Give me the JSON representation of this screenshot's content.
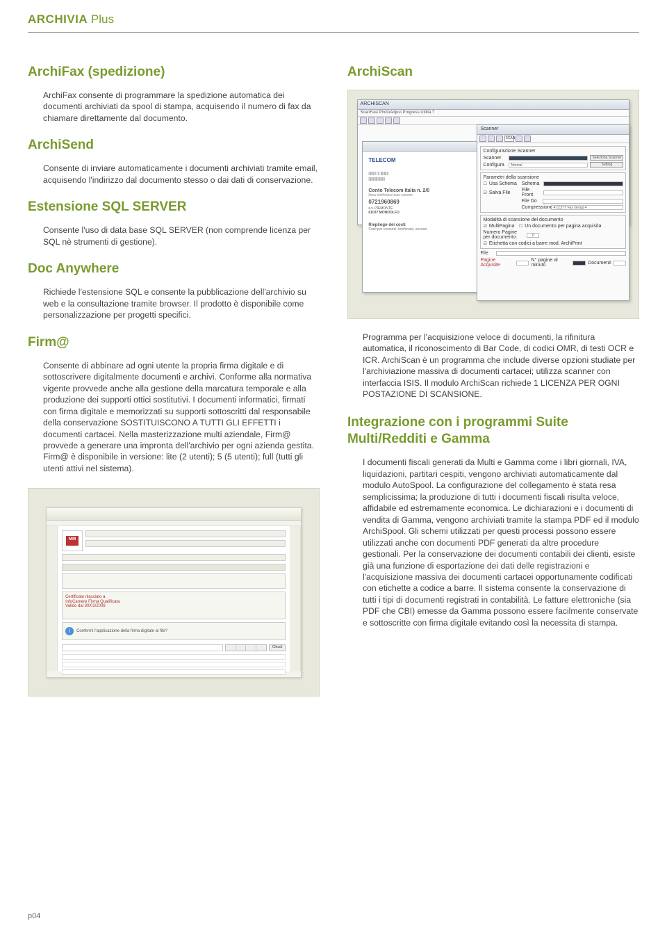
{
  "header": {
    "brand_bold": "ARCHIVIA",
    "brand_light": " Plus"
  },
  "left": {
    "s1": {
      "title": "ArchiFax (spedizione)",
      "body": "ArchiFax consente di programmare la spedizione automatica dei documenti archiviati da spool di stampa, acquisendo il numero di fax da chiamare direttamente dal documento."
    },
    "s2": {
      "title": "ArchiSend",
      "body": "Consente di inviare automaticamente i documenti archiviati tramite email, acquisendo l'indirizzo dal documento stesso o dai dati di conservazione."
    },
    "s3": {
      "title": "Estensione SQL SERVER",
      "body": "Consente l'uso di data base SQL SERVER (non comprende licenza per SQL nè strumenti di gestione)."
    },
    "s4": {
      "title": "Doc Anywhere",
      "body": "Richiede l'estensione SQL e consente la pubblicazione dell'archivio su web e la consultazione tramite browser. Il prodotto è disponibile come personalizzazione per progetti specifici."
    },
    "s5": {
      "title": "Firm@",
      "body": "Consente di abbinare ad ogni utente la propria firma digitale e di sottoscrivere digitalmente documenti e archivi. Conforme alla normativa vigente provvede anche alla gestione della marcatura temporale e alla produzione dei supporti ottici sostitutivi. I documenti informatici, firmati con firma digitale e memorizzati su supporti sottoscritti dal responsabile della conservazione SOSTITUISCONO A TUTTI GLI EFFETTI i documenti cartacei. Nella masterizzazione multi aziendale, Firm@ provvede a generare una impronta dell'archivio per ogni azienda gestita. Firm@ è disponibile in versione: lite (2 utenti); 5 (5 utenti); full (tutti gli utenti attivi nel sistema)."
    }
  },
  "right": {
    "s1": {
      "title": "ArchiScan",
      "body": "Programma per l'acquisizione veloce di documenti, la rifinitura automatica, il riconoscimento di Bar Code, di codici OMR, di testi OCR e ICR. ArchiScan è un programma che include diverse opzioni studiate per l'archiviazione massiva di documenti cartacei; utilizza scanner con interfaccia ISIS. Il modulo ArchiScan richiede 1 LICENZA PER OGNI POSTAZIONE DI SCANSIONE."
    },
    "s2": {
      "title": "Integrazione con i programmi Suite Multi/Redditi e Gamma",
      "body": "I documenti fiscali generati da Multi e Gamma come i libri giornali, IVA, liquidazioni, partitari cespiti, vengono archiviati automaticamente dal modulo AutoSpool. La configurazione del collegamento è stata resa semplicissima; la produzione di tutti i documenti fiscali risulta veloce, affidabile ed estremamente economica. Le dichiarazioni e i documenti di vendita di Gamma, vengono archiviati tramite la stampa PDF ed il modulo ArchiSpool. Gli schemi utilizzati per questi processi possono essere utilizzati anche con documenti PDF generati da altre procedure gestionali. Per la conservazione dei documenti contabili dei clienti, esiste già una funzione di esportazione dei dati delle registrazioni e l'acquisizione massiva dei documenti cartacei opportunamente codificati con etichette a codice a barre. Il sistema consente la conservazione di tutti i tipi di documenti registrati in contabilità. Le fatture elettroniche (sia PDF che CBI) emesse da Gamma possono essere facilmente conservate e sottoscritte con firma digitale evitando così la necessita di stampa."
    }
  },
  "figA": {
    "win_title": "ARCHISCAN",
    "menu": "ScanFast  PhotoAdjust  Progress  Utilità  ?",
    "sc_title": "Scanner",
    "cfg": "Configurazione Scanner",
    "scanner_lbl": "Scanner",
    "sel_scanner": "Seleziona Scanner",
    "configura": "Configura",
    "normal": "Normal",
    "setting": "Setting",
    "params": "Parametri della scansione",
    "usa_schema": "Usa Schema",
    "schema": "Schema",
    "salva_file": "Salva File",
    "file_front": "File Front",
    "file_do": "File Do",
    "compressione": "Compressione",
    "comp_val": "4  CCITT Fax Group 4",
    "modalita": "Modalità di scansione del documento",
    "multipagina": "MultiPagina",
    "multipagina_desc": "Un documento per pagina acquisita",
    "numero_pagine": "Numero Pagine per documento:",
    "np_val": "0",
    "etichetta": "Etichetta con codici a barre mod. ArchiPrint",
    "file_lbl": "File",
    "pagine_acq": "Pagine Acquisite",
    "pagine_min": "N° pagine al minuto",
    "documenti": "Documenti",
    "doc_telecom": "TELECOM",
    "doc_conto": "Conto Telecom Italia n. 2/0",
    "doc_num": "0721960869",
    "doc_addr": "s.v. PIEMONTE",
    "doc_city": "61037 MONDOLFO",
    "doc_riep": "Riepilogo dei costi",
    "doc_costi": "Costi per consumi: telefonate, accessi"
  },
  "page_number": "p04"
}
